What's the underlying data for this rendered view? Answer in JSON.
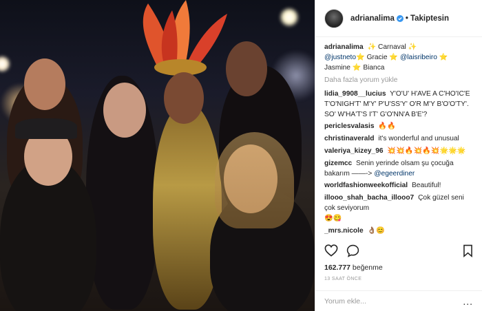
{
  "post": {
    "author": "adrianalima",
    "follow_state": "Takiptesin",
    "caption": {
      "author": "adrianalima",
      "text_1": "Carnaval",
      "mention_1": "@justneto",
      "text_2": "Gracie",
      "mention_2": "@laisribeiro",
      "text_3": "Jasmine",
      "text_4": "Bianca"
    },
    "load_more": "Daha fazla yorum yükle",
    "comments": [
      {
        "user": "lidia_9908__lucius",
        "text": "Y'O'U' H'AVE A C'HO'IC'E T'O'NIGH'T' M'Y' P'U'SS'Y' O'R M'Y B'O'O'TY'. SO' W'HA'T'S I'T' G'O'NN'A B'E'?"
      },
      {
        "user": "periclesvalasis",
        "text": "🔥🔥"
      },
      {
        "user": "christinaverald",
        "text": "it's wonderful and unusual"
      },
      {
        "user": "valeriya_kizey_96",
        "text": "💥💥🔥💥🔥💥🌟🌟🌟"
      },
      {
        "user": "gizemcc",
        "text": "Senin yerinde olsam şu çocuğa bakarım ——->",
        "mention": "@egeerdiner"
      },
      {
        "user": "worldfashionweekofficial",
        "text": "Beautiful!"
      },
      {
        "user": "illooo_shah_bacha_illooo7",
        "text": "Çok güzel seni çok seviyorum"
      },
      {
        "user": "",
        "text": "😍😋"
      },
      {
        "user": "_mrs.nicole",
        "text": "👌🏽😊"
      }
    ],
    "likes_count": "162.777",
    "likes_label": "beğenme",
    "timestamp": "13 SAAT ÖNCE",
    "add_comment_placeholder": "Yorum ekle...",
    "more_options": "..."
  },
  "icons": {
    "like": "heart-icon",
    "comment": "comment-icon",
    "save": "bookmark-icon",
    "verified": "verified-badge-icon"
  },
  "colors": {
    "verified_blue": "#3897f0",
    "text": "#262626",
    "muted": "#999999",
    "mention": "#003569"
  }
}
